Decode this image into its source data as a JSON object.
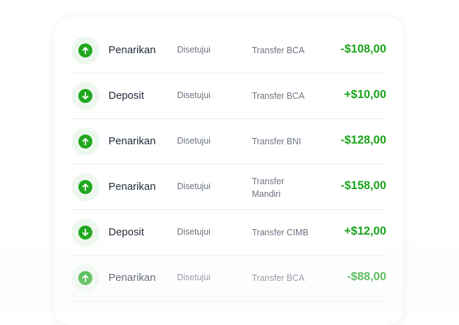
{
  "colors": {
    "accent": "#20a820",
    "icon_bg": "#eef7ee",
    "amount": "#1aa31a"
  },
  "transactions": [
    {
      "type": "Penarikan",
      "icon": "arrow-up-icon",
      "status": "Disetujui",
      "method": "Transfer BCA",
      "amount": "-$108,00"
    },
    {
      "type": "Deposit",
      "icon": "arrow-down-icon",
      "status": "Disetujui",
      "method": "Transfer BCA",
      "amount": "+$10,00"
    },
    {
      "type": "Penarikan",
      "icon": "arrow-up-icon",
      "status": "Disetujui",
      "method": "Transfer BNI",
      "amount": "-$128,00"
    },
    {
      "type": "Penarikan",
      "icon": "arrow-up-icon",
      "status": "Disetujui",
      "method": "Transfer Mandiri",
      "amount": "-$158,00"
    },
    {
      "type": "Deposit",
      "icon": "arrow-down-icon",
      "status": "Disetujui",
      "method": "Transfer CIMB",
      "amount": "+$12,00"
    },
    {
      "type": "Penarikan",
      "icon": "arrow-up-icon",
      "status": "Disetujui",
      "method": "Transfer BCA",
      "amount": "-$88,00"
    }
  ]
}
